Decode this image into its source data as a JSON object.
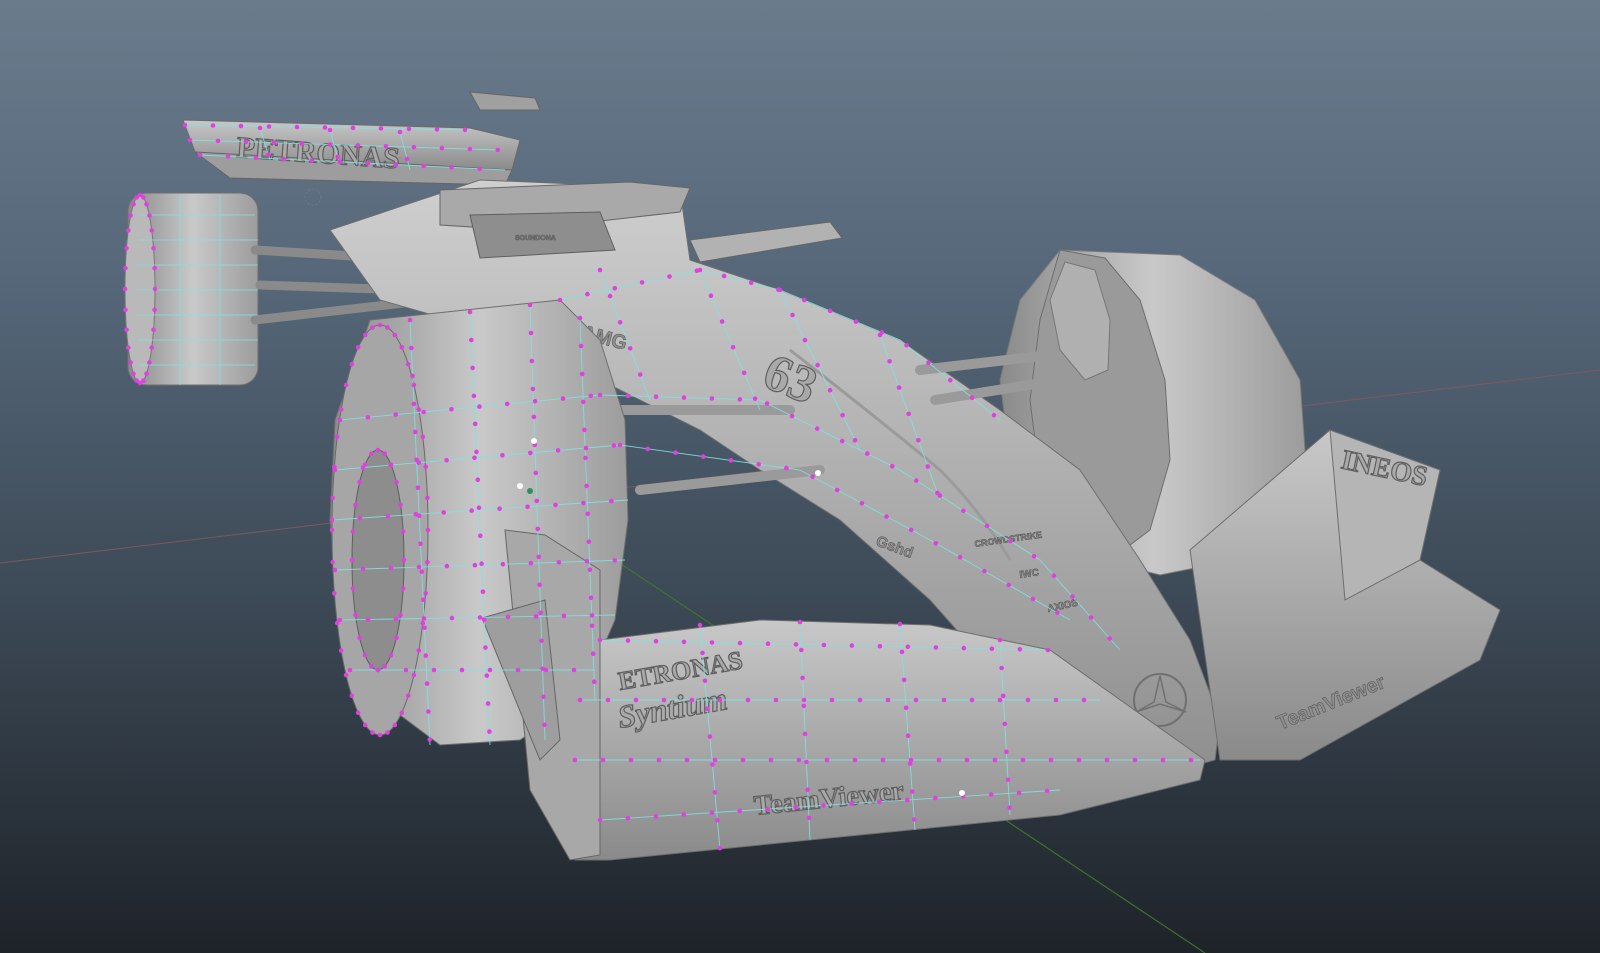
{
  "viewport": {
    "background_top": "#6a7c8c",
    "background_bottom": "#1e2329",
    "grid_x_axis_color": "#8a5a5a",
    "grid_z_axis_color": "#3e7a2a",
    "mesh_color": "#b8b8b8",
    "edge_color": "#7fe3e3",
    "vertex_color": "#e040e0"
  },
  "model": {
    "name": "F1 car",
    "livery": {
      "rear_wing": "PETRONAS",
      "front_wing_1": "ETRONAS",
      "front_wing_2": "Syntium",
      "front_wing_3": "TeamViewer",
      "endplate_right": "INEOS",
      "car_number": "63",
      "sidepod_brand": "AMG",
      "nose_1": "CROWDSTRIKE",
      "nose_2": "IWC",
      "nose_3": "AXIOS",
      "nose_badge": "Gshd",
      "right_wing_sponsor": "TeamViewer",
      "halo_text": "SOUNDONA"
    }
  }
}
